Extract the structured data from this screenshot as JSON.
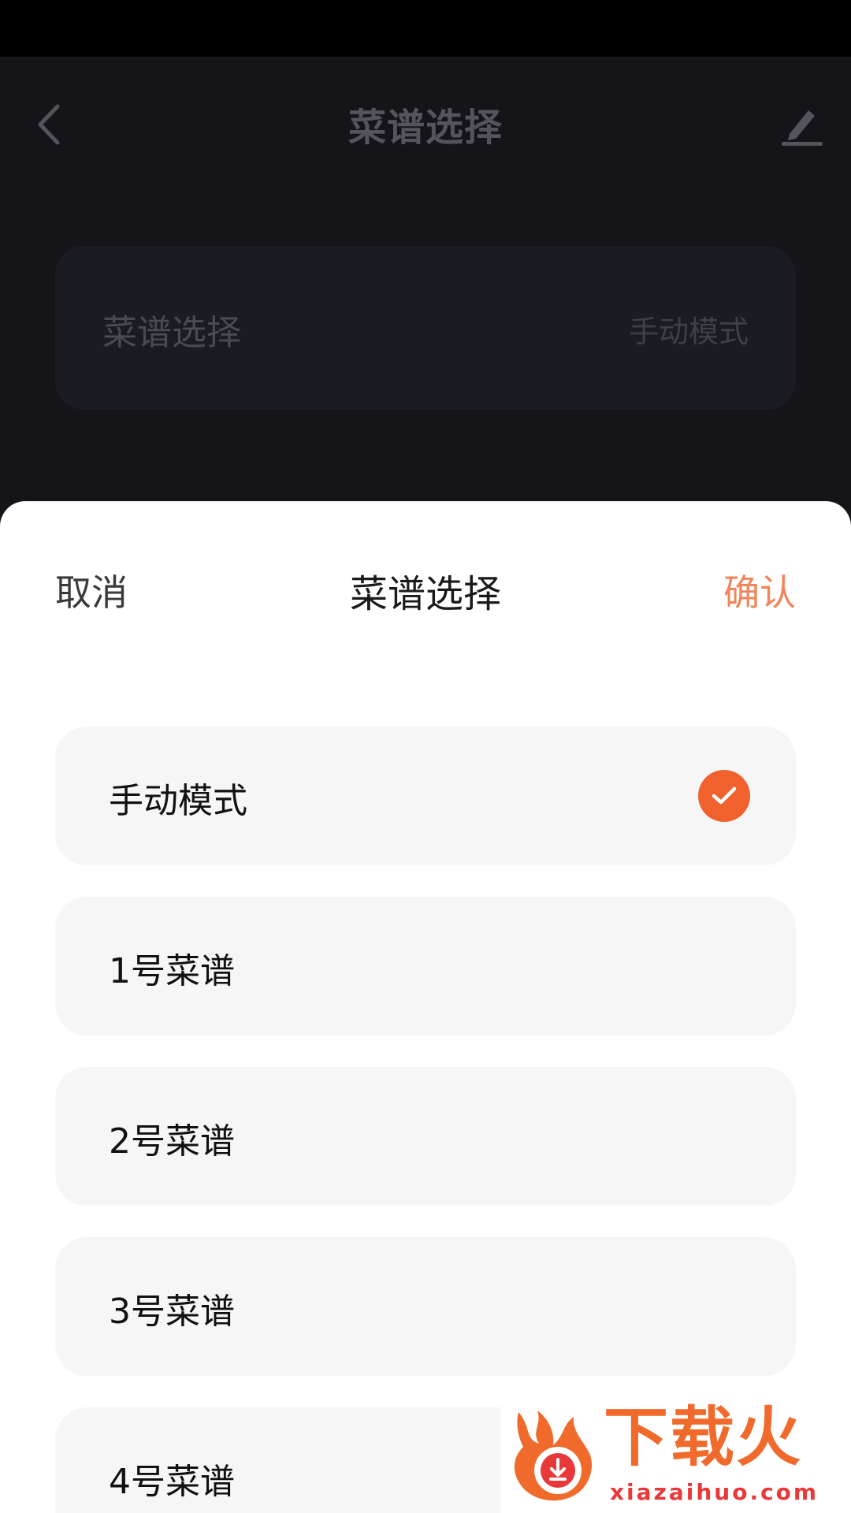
{
  "colors": {
    "accent": "#f0612d",
    "confirm": "#f0845a",
    "brand_orange": "#f06a2c",
    "brand_red": "#e8383a"
  },
  "background": {
    "header": {
      "title": "菜谱选择",
      "back_icon": "chevron-left-icon",
      "edit_icon": "pencil-icon"
    },
    "card": {
      "label": "菜谱选择",
      "value": "手动模式"
    }
  },
  "sheet": {
    "cancel_label": "取消",
    "title": "菜谱选择",
    "confirm_label": "确认",
    "options": [
      {
        "label": "手动模式",
        "selected": true
      },
      {
        "label": "1号菜谱",
        "selected": false
      },
      {
        "label": "2号菜谱",
        "selected": false
      },
      {
        "label": "3号菜谱",
        "selected": false
      },
      {
        "label": "4号菜谱",
        "selected": false
      }
    ],
    "selected_icon": "checkmark-icon"
  },
  "watermark": {
    "brand": "下载火",
    "url": "xiazaihuo.com"
  }
}
